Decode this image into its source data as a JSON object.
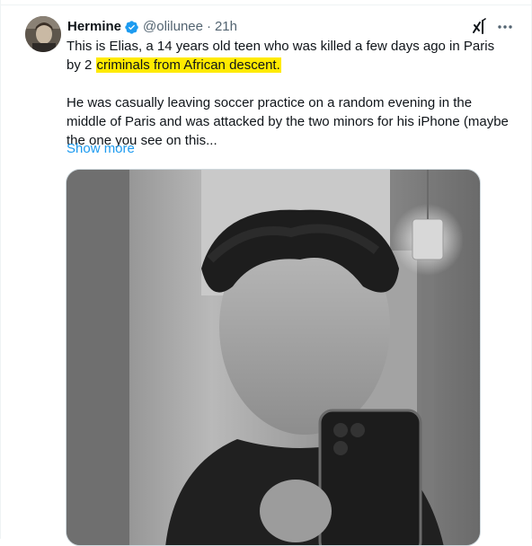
{
  "tweet": {
    "author_name": "Hermine",
    "handle": "@olilunee",
    "separator": "·",
    "time": "21h",
    "text_part1": "This is Elias, a 14 years old teen who was killed a few days ago in Paris by 2 ",
    "text_highlight": "criminals from African descent.",
    "text_para2": "He was casually leaving soccer practice on a random evening in the middle of Paris and was attacked by the two minors for his iPhone (maybe the one you see on this...",
    "show_more": "Show more"
  },
  "icons": {
    "verified": "verified-badge-icon",
    "grok": "grok-icon",
    "more": "more-options-icon"
  },
  "colors": {
    "verified_blue": "#1d9bf0",
    "link_blue": "#1d9bf0",
    "highlight": "#ffea00",
    "secondary_text": "#536471",
    "primary_text": "#0f1419"
  }
}
